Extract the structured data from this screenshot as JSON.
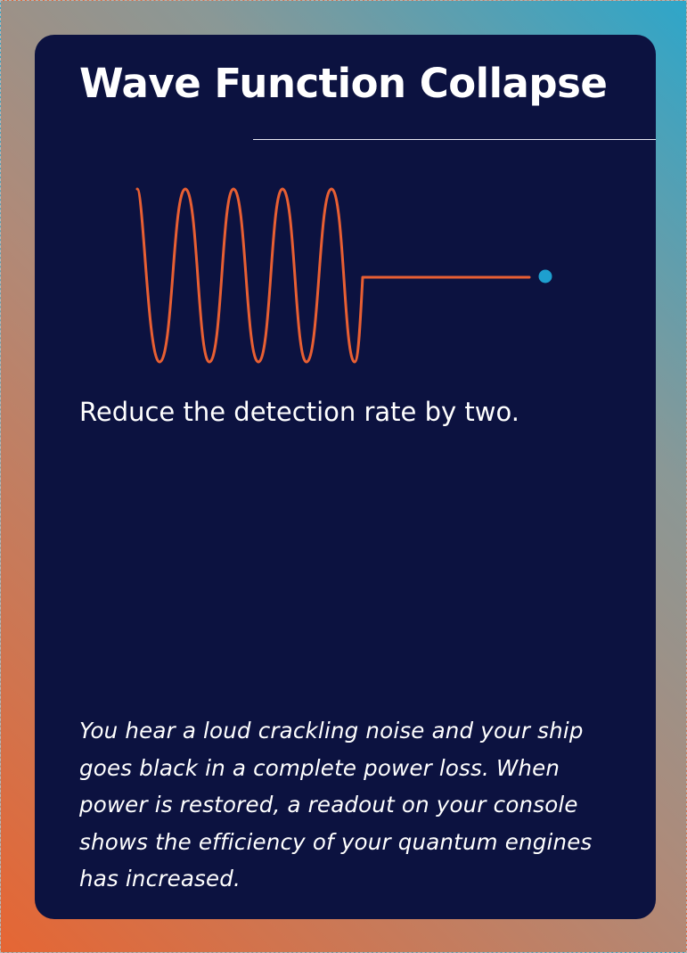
{
  "card": {
    "title": "Wave Function Collapse",
    "effect": "Reduce the detection rate by two.",
    "flavor": "You hear a loud crackling noise and your ship goes black in a complete power loss. When power is restored, a readout on your console shows the efficiency of your quantum engines has increased."
  },
  "colors": {
    "panel": "#0c1240",
    "wave": "#e85f33",
    "dot": "#1e9fcf",
    "text": "#ffffff"
  },
  "icons": {
    "wave": "wave-collapse-icon"
  }
}
